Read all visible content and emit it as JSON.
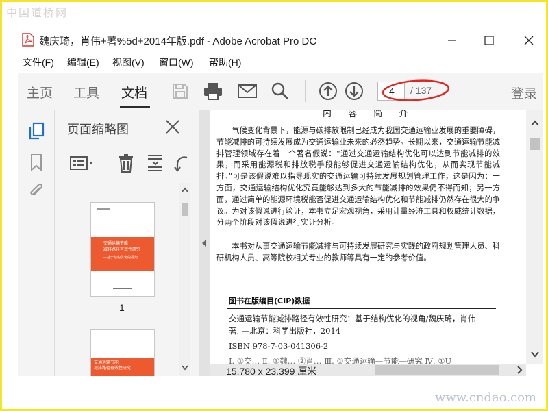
{
  "watermark": {
    "top": "中国道桥网",
    "bottom": "www.cndao.com"
  },
  "window": {
    "title": "魏庆琦，肖伟+著%5d+2014年版.pdf - Adobe Acrobat Pro DC"
  },
  "menu": [
    "文件(F)",
    "编辑(E)",
    "视图(V)",
    "窗口(W)",
    "帮助(H)"
  ],
  "toolbar": {
    "tabs": [
      "主页",
      "工具",
      "文档"
    ],
    "active_tab": "文档",
    "page_current": "4",
    "page_total": "/ 137",
    "login": "登录",
    "icons": [
      "save-icon",
      "print-icon",
      "email-icon",
      "search-icon",
      "page-up-icon",
      "page-down-icon"
    ]
  },
  "panel": {
    "title": "页面缩略图",
    "thumb_label": "1"
  },
  "thumbnail": {
    "title_lines": [
      "交通运输节能",
      "减排路径有效性研究",
      "—基于结构优化的视角"
    ],
    "title_lines_2": [
      "交通运输节能",
      "减排路径有效性研究"
    ]
  },
  "document": {
    "heading": "内 容 简 介",
    "paragraphs": [
      "气候变化背景下，能源与碳排放限制已经成为我国交通运输业发展的重要障碍，节能减排的可持续发展成为交通运输业未来的必然趋势。长期以来，交通运输节能减排管理领域存在着一个著名假说：“通过交通运输结构优化可以达到节能减排的效果，而采用能源税和排放税手段能够促进交通运输结构优化，从而实现节能减排。”可是该假说难以指导现实的交通运输可持续发展规划管理工作，这是因为：一方面，交通运输结构优化究竟能够达到多大的节能减排的效果仍不得而知；另一方面，通过简单的能源环境税能否促进交通运输结构优化和节能减排仍然存在很大的争议。为对该假说进行验证，本书立足宏观视角，采用计量经济工具和权威统计数据，分两个阶段对该假说进行实证分析。",
      "本书对从事交通运输节能减排与可持续发展研究与实践的政府规划管理人员、科研机构人员、高等院校相关专业的教师等具有一定的参考价值。"
    ],
    "cip_title": "图书在版编目(CIP)数据",
    "cip_lines": [
      "交通运输节能减排路径有效性研究：基于结构优化的视角/魏庆琦，肖伟",
      "著. —北京：科学出版社，2014",
      "ISBN 978-7-03-041306-2",
      "Ⅰ. ①交…  Ⅱ. ①魏…  ②肖…  Ⅲ. ①交通运输—节能—研究  Ⅳ. ①U"
    ]
  },
  "status": {
    "page_size": "15.780 x 23.399 厘米"
  },
  "colors": {
    "annotation_red": "#e0271f",
    "thumb_orange": "#ee5a2f",
    "frame_yellow": "#f2e52a"
  }
}
